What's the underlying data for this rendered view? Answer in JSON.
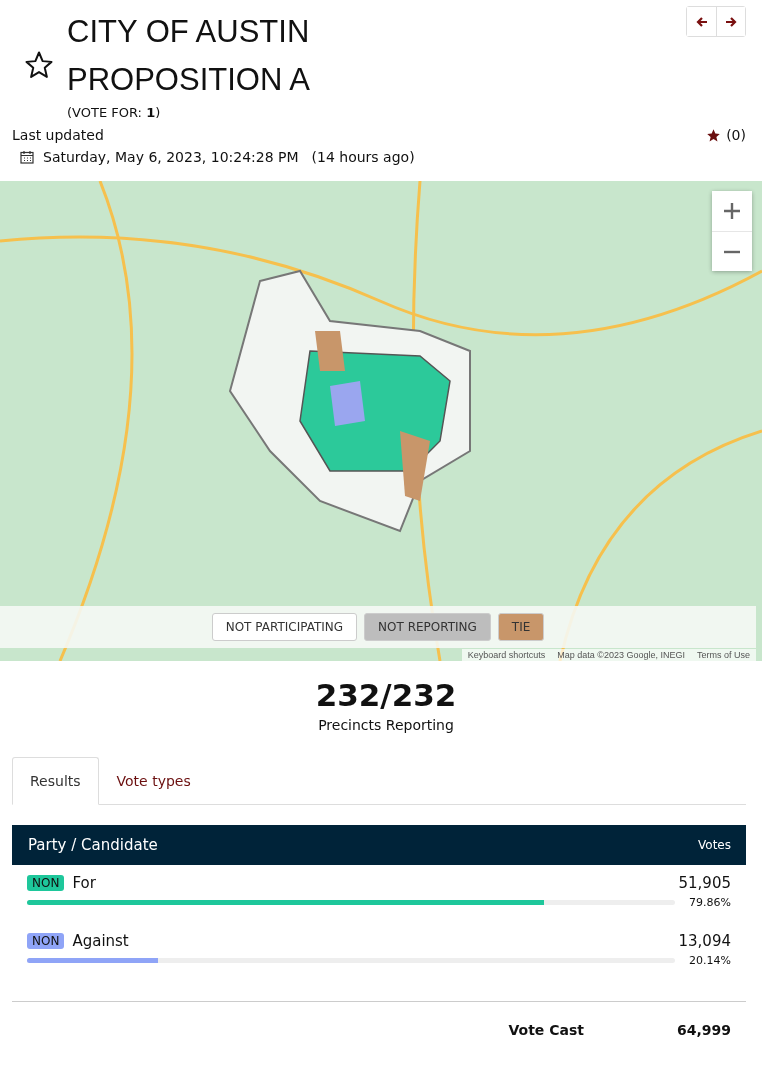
{
  "header": {
    "title_lines": [
      "CITY OF AUSTIN",
      "PROPOSITION A"
    ],
    "vote_for": "(VOTE FOR: **1**)",
    "favorite": false
  },
  "last_updated": {
    "label": "Last updated",
    "timestamp": "Saturday, May 6, 2023, 10:24:28 PM",
    "relative": "(14 hours ago)",
    "favorites_count": "(0)"
  },
  "map": {
    "legend": [
      {
        "label": "NOT PARTICIPATING",
        "color": "#ffffff"
      },
      {
        "label": "NOT REPORTING",
        "color": "#bdbdbd"
      },
      {
        "label": "TIE",
        "color": "#c8966a"
      }
    ],
    "attribution": [
      "Keyboard shortcuts",
      "Map data ©2023 Google, INEGI",
      "Terms of Use"
    ]
  },
  "precincts": {
    "count": "232/232",
    "label": "Precincts Reporting"
  },
  "tabs": [
    {
      "label": "Results",
      "selected": true
    },
    {
      "label": "Vote types",
      "selected": false
    }
  ],
  "table": {
    "columns": [
      "Party / Candidate",
      "Votes"
    ],
    "rows": [
      {
        "party": "NON",
        "name": "For",
        "votes": "51,905",
        "percent": "79.86%",
        "level": 0.7986,
        "color": "#1ec79b"
      },
      {
        "party": "NON",
        "name": "Against",
        "votes": "13,094",
        "percent": "20.14%",
        "level": 0.2014,
        "color": "#8fa4f7"
      }
    ],
    "total": {
      "label": "Vote Cast",
      "value": "64,999"
    }
  }
}
